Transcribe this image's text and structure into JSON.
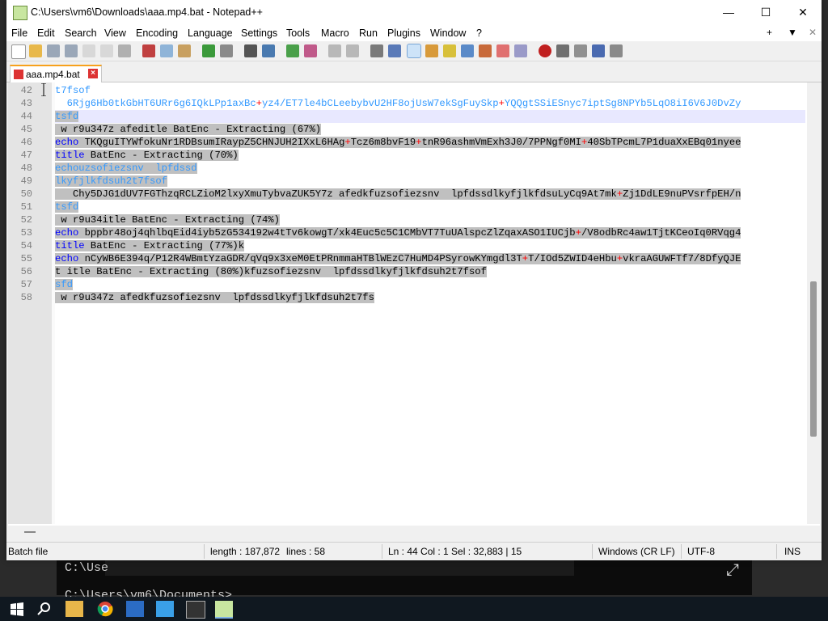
{
  "window": {
    "title": "C:\\Users\\vm6\\Downloads\\aaa.mp4.bat - Notepad++"
  },
  "menu": [
    "File",
    "Edit",
    "Search",
    "View",
    "Encoding",
    "Language",
    "Settings",
    "Tools",
    "Macro",
    "Run",
    "Plugins",
    "Window",
    "?"
  ],
  "menu_right": {
    "add": "+",
    "down": "▼",
    "close": "✕"
  },
  "tab": {
    "label": "aaa.mp4.bat"
  },
  "lines": [
    {
      "n": "42",
      "t": "t7fsof"
    },
    {
      "n": "43",
      "t": "  6Rjg6Hb0tkGbHT6URr6g6IQkLPp1axBc+yz4/ET7le4bCLeebybvU2HF8ojUsW7ekSgFuySkp+YQQgtSSiESnyc7iptSg8NPYb5LqO8iI6V6J0DvZy"
    },
    {
      "n": "44",
      "t": "tsfd"
    },
    {
      "n": "45",
      "t": " w r9u347z afeditle BatEnc - Extracting (67%)"
    },
    {
      "n": "46",
      "t": "echo TKQguITYWfokuNr1RDBsumIRaypZ5CHNJUH2IXxL6HAg+Tcz6m8bvF19+tnR96ashmVmExh3J0/7PPNgf0MI+40SbTPcmL7P1duaXxEBq01nyee"
    },
    {
      "n": "47",
      "t": "title BatEnc - Extracting (70%)"
    },
    {
      "n": "48",
      "t": "echouzsofiezsnv  lpfdssd"
    },
    {
      "n": "49",
      "t": "lkyfjlkfdsuh2t7fsof"
    },
    {
      "n": "50",
      "t": "   Chy5DJG1dUV7FGThzqRCLZioM2lxyXmuTybvaZUK5Y7z afedkfuzsofiezsnv  lpfdssdlkyfjlkfdsuLyCq9At7mk+Zj1DdLE9nuPVsrfpEH/n"
    },
    {
      "n": "51",
      "t": "tsfd"
    },
    {
      "n": "52",
      "t": " w r9u34itle BatEnc - Extracting (74%)"
    },
    {
      "n": "53",
      "t": "echo bppbr48oj4qhlbqEid4iyb5zG534192w4tTv6kowgT/xk4Euc5c5C1CMbVT7TuUAlspcZlZqaxASO1IUCjb+/V8odbRc4aw1TjtKCeoIq0RVqg4"
    },
    {
      "n": "54",
      "t": "title BatEnc - Extracting (77%)k"
    },
    {
      "n": "55",
      "t": "echo nCyWB6E394q/P12R4WBmtYzaGDR/qVq9x3xeM0EtPRnmmaHTBlWEzC7HuMD4PSyrowKYmgdl3T+T/IOd5ZWID4eHbu+vkraAGUWFTf7/8DfyQJE"
    },
    {
      "n": "56",
      "t": "t itle BatEnc - Extracting (80%)kfuzsofiezsnv  lpfdssdlkyfjlkfdsuh2t7fsof"
    },
    {
      "n": "57",
      "t": "sfd"
    },
    {
      "n": "58",
      "t": " w r9u347z afedkfuzsofiezsnv  lpfdssdlkyfjlkfdsuh2t7fs"
    }
  ],
  "status": {
    "type": "Batch file",
    "length": "length : 187,872",
    "lines": "lines : 58",
    "pos": "Ln : 44    Col : 1    Sel : 32,883 | 15",
    "eol": "Windows (CR LF)",
    "enc": "UTF-8",
    "ins": "INS"
  },
  "console": {
    "line1": "C:\\Use",
    "line2": "C:\\Users\\vm6\\Documents>"
  },
  "icons": [
    "start-icon",
    "search-icon",
    "file-explorer-icon",
    "chrome-icon",
    "word-icon",
    "notepad-icon",
    "terminal-icon",
    "notepadpp-icon"
  ]
}
